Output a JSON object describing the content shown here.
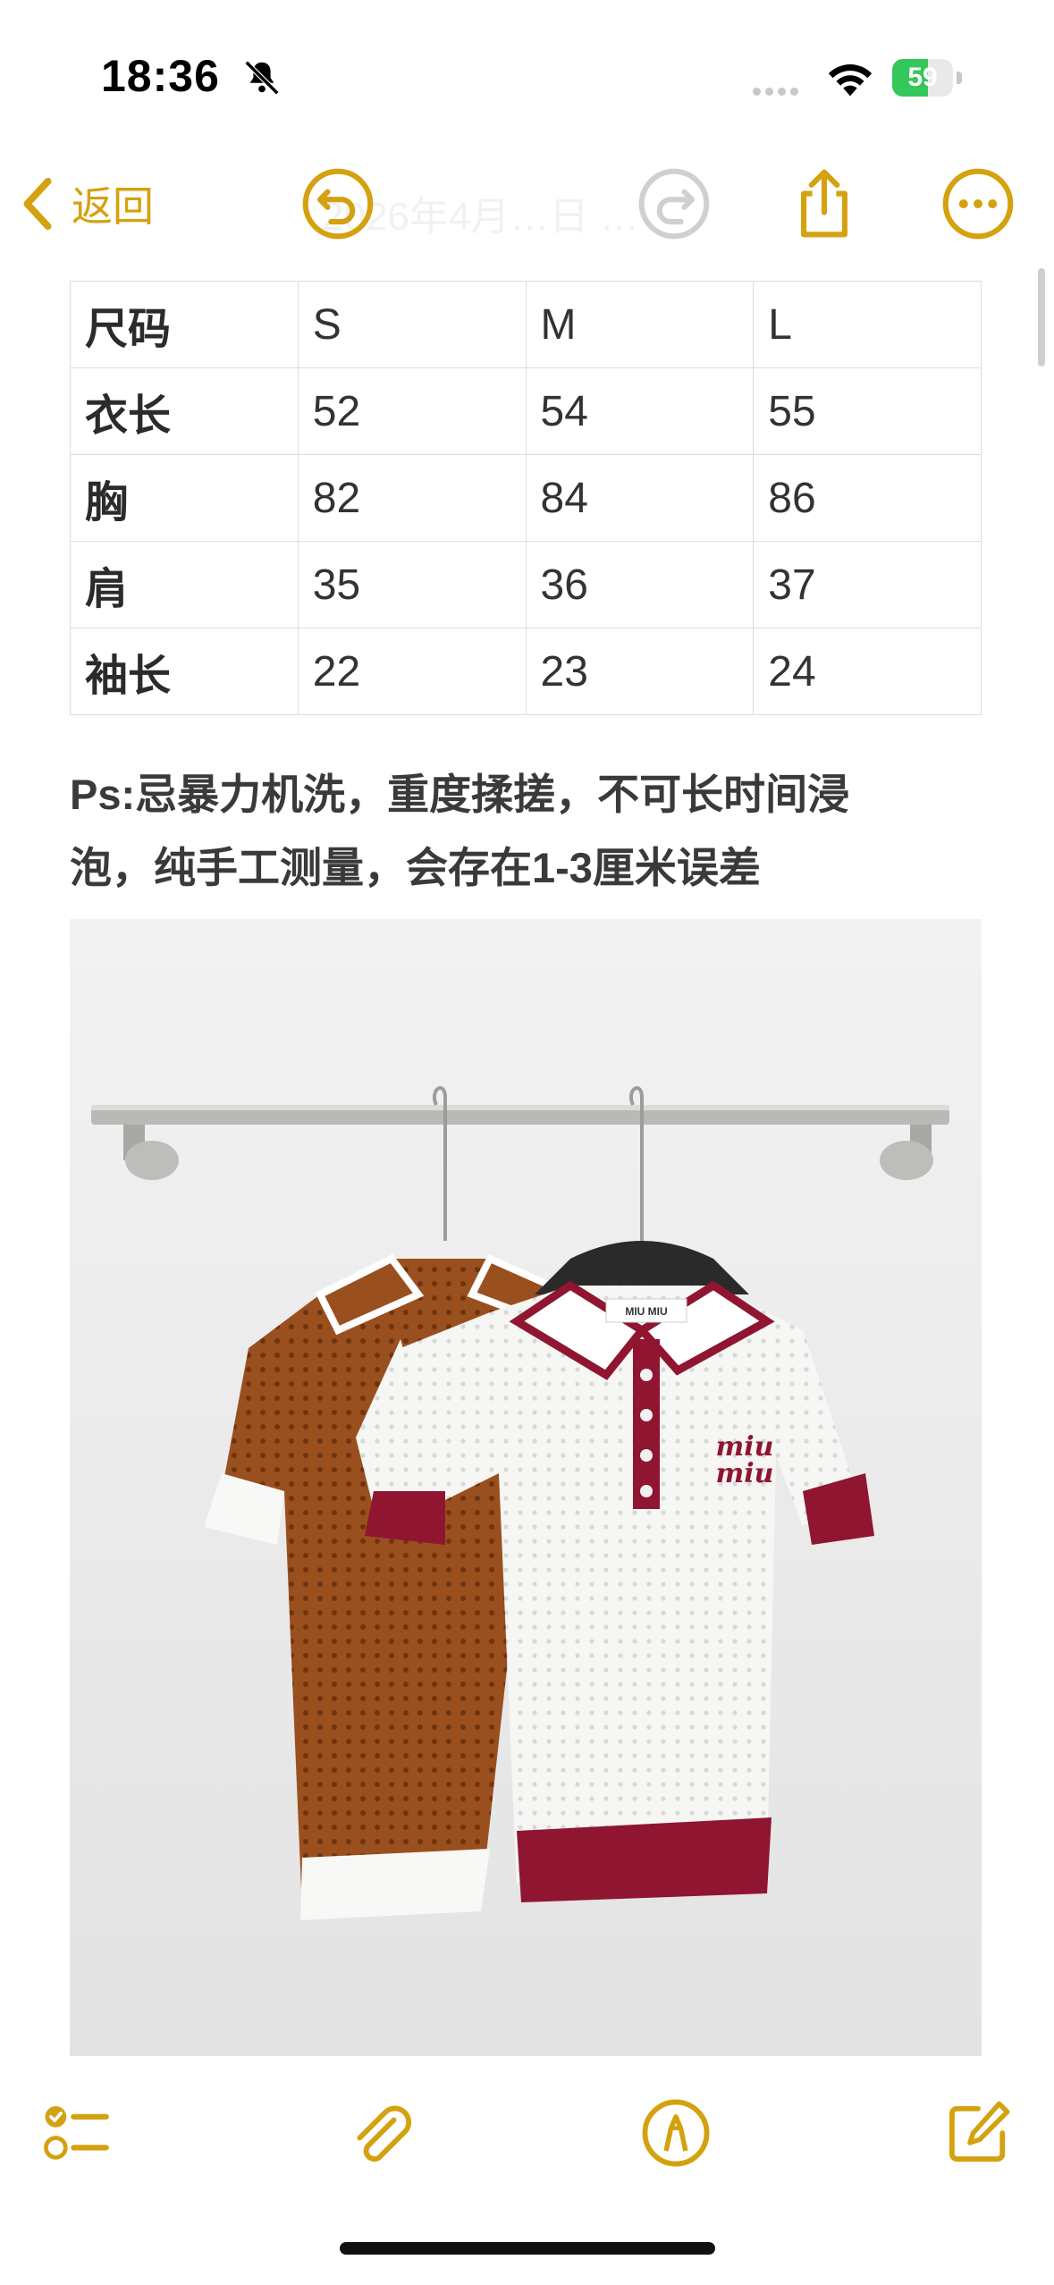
{
  "status_bar": {
    "time": "18:36",
    "battery_percent": "59",
    "battery_level": 0.59,
    "icons": [
      "bell-slash-icon",
      "cellular-dots-icon",
      "wifi-icon",
      "battery-charging-icon"
    ]
  },
  "nav": {
    "back_label": "返回",
    "title": "2026年4月…日 …",
    "icons": [
      "chevron-left-icon",
      "undo-icon",
      "redo-icon",
      "share-icon",
      "more-icon"
    ]
  },
  "size_table": {
    "header": [
      "尺码",
      "S",
      "M",
      "L"
    ],
    "rows": [
      [
        "衣长",
        "52",
        "54",
        "55"
      ],
      [
        "胸",
        "82",
        "84",
        "86"
      ],
      [
        "肩",
        "35",
        "36",
        "37"
      ],
      [
        "袖长",
        "22",
        "23",
        "24"
      ]
    ]
  },
  "note": {
    "line1": "Ps:忌暴力机洗，重度揉搓，不可长时间浸",
    "line2": "泡，纯手工测量，会存在1-3厘米误差"
  },
  "photo": {
    "tag_text": "MIU MIU",
    "logo_line1": "miu",
    "logo_line2": "miu"
  },
  "toolbar": {
    "icons": [
      "checklist-icon",
      "paperclip-icon",
      "markup-pen-icon",
      "compose-icon"
    ]
  },
  "colors": {
    "accent": "#d4a10f",
    "brown_shirt": "#9a4f1f",
    "burgundy_trim": "#8f1530",
    "white_shirt": "#f4f4f2"
  }
}
